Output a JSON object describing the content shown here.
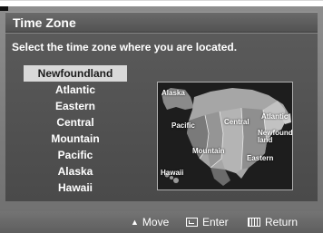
{
  "menu": {
    "title": "Time Zone",
    "instruction": "Select the time zone where you are located."
  },
  "zones": [
    {
      "label": "Newfoundland",
      "selected": true
    },
    {
      "label": "Atlantic",
      "selected": false
    },
    {
      "label": "Eastern",
      "selected": false
    },
    {
      "label": "Central",
      "selected": false
    },
    {
      "label": "Mountain",
      "selected": false
    },
    {
      "label": "Pacific",
      "selected": false
    },
    {
      "label": "Alaska",
      "selected": false
    },
    {
      "label": "Hawaii",
      "selected": false
    }
  ],
  "map": {
    "labels": {
      "alaska": "Alaska",
      "pacific": "Pacific",
      "central": "Central",
      "atlantic": "Atlantic",
      "newfoundland": "Newfound-\nland",
      "mountain": "Mountain",
      "eastern": "Eastern",
      "hawaii": "Hawaii"
    }
  },
  "nav": {
    "move_label": "Move",
    "enter_label": "Enter",
    "return_label": "Return",
    "move_icon": "up-down-arrow-icon",
    "enter_icon": "enter-icon",
    "return_icon": "return-icon"
  },
  "colors": {
    "selected_bg": "#d9d9d9",
    "panel": "#4f4f4f",
    "text": "#ffffff"
  }
}
